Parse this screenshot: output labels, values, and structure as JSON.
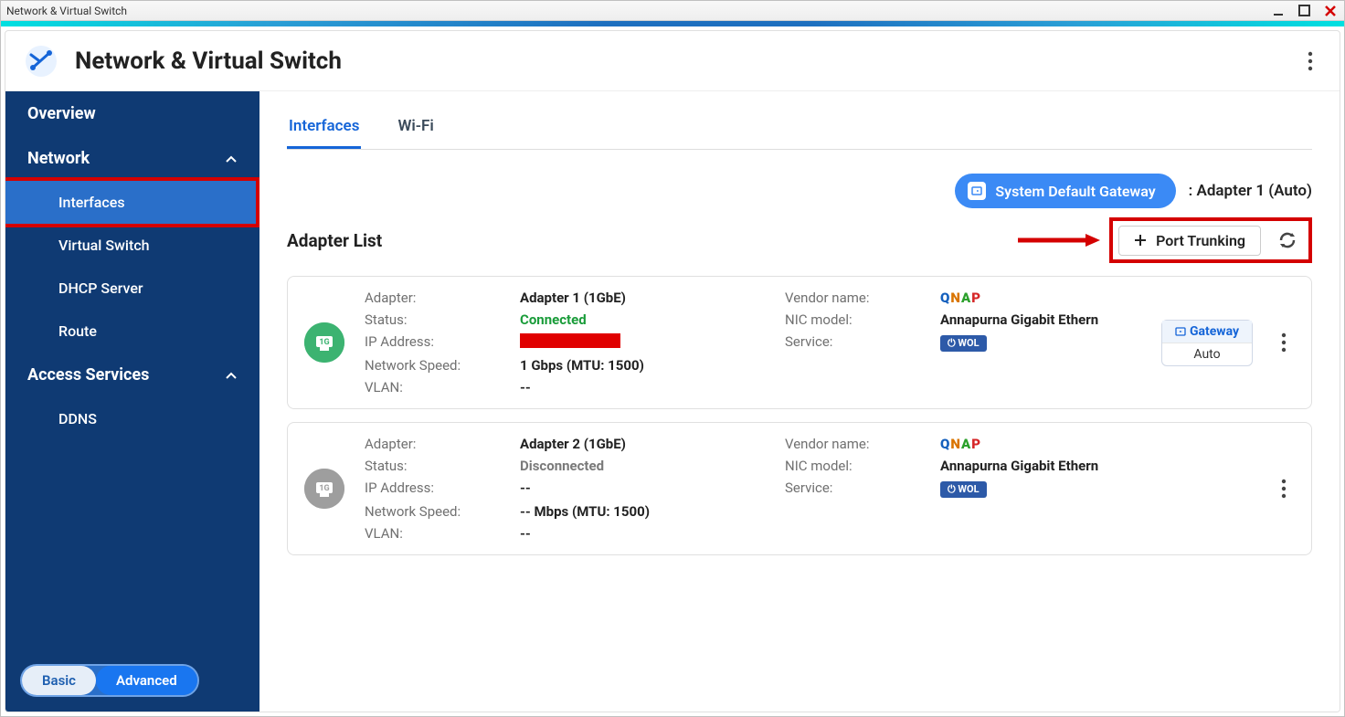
{
  "window_title": "Network & Virtual Switch",
  "header": {
    "title": "Network & Virtual Switch"
  },
  "sidebar": {
    "overview": "Overview",
    "network": "Network",
    "interfaces": "Interfaces",
    "vswitch": "Virtual Switch",
    "dhcp": "DHCP Server",
    "route": "Route",
    "access": "Access Services",
    "ddns": "DDNS",
    "basic": "Basic",
    "advanced": "Advanced"
  },
  "tabs": {
    "interfaces": "Interfaces",
    "wifi": "Wi-Fi"
  },
  "toolbar": {
    "sys_gw": "System Default Gateway",
    "sys_gw_val": ":  Adapter 1 (Auto)",
    "list_title": "Adapter List",
    "port_trunking": "Port Trunking"
  },
  "labels": {
    "adapter": "Adapter:",
    "status": "Status:",
    "ip": "IP Address:",
    "speed": "Network Speed:",
    "vlan": "VLAN:",
    "vendor": "Vendor name:",
    "nic": "NIC model:",
    "service": "Service:"
  },
  "badges": {
    "gateway": "Gateway",
    "auto": "Auto",
    "wol": "⏻ WOL",
    "nic_speed": "1G"
  },
  "adapters": [
    {
      "name": "Adapter 1 (1GbE)",
      "status": "Connected",
      "status_class": "conn",
      "ip_redacted": true,
      "speed": "1 Gbps (MTU: 1500)",
      "vlan": "--",
      "nic": "Annapurna Gigabit Ethern",
      "gateway": true,
      "up": true
    },
    {
      "name": "Adapter 2 (1GbE)",
      "status": "Disconnected",
      "status_class": "disc",
      "ip": "--",
      "speed": "-- Mbps (MTU: 1500)",
      "vlan": "--",
      "nic": "Annapurna Gigabit Ethern",
      "gateway": false,
      "up": false
    }
  ]
}
